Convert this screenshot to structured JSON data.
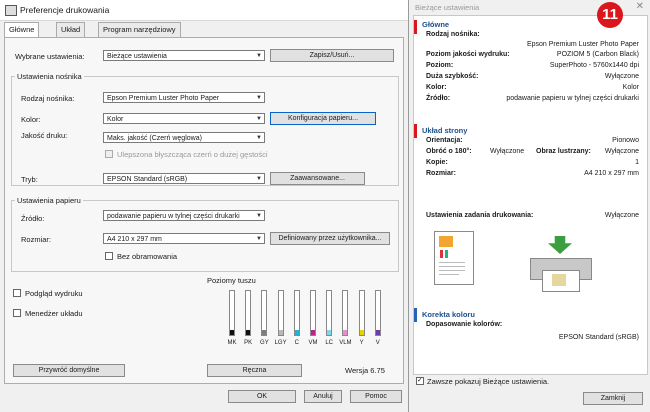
{
  "window": {
    "title": "Preferencje drukowania"
  },
  "tabs": [
    {
      "label": "Główne"
    },
    {
      "label": "Układ"
    },
    {
      "label": "Program narzędziowy"
    }
  ],
  "main": {
    "selected_settings_label": "Wybrane ustawienia:",
    "selected_settings_value": "Bieżące ustawienia",
    "save_delete_button": "Zapisz/Usuń...",
    "media_group": "Ustawienia nośnika",
    "media_type_label": "Rodzaj nośnika:",
    "media_type_value": "Epson Premium Luster Photo Paper",
    "color_label": "Kolor:",
    "color_value": "Kolor",
    "paper_config_button": "Konfiguracja papieru...",
    "quality_label": "Jakość druku:",
    "quality_value": "Maks. jakość (Czerń węglowa)",
    "enhanced_black": "Ulepszona błyszcząca czerń o dużej gęstości",
    "mode_label": "Tryb:",
    "mode_value": "EPSON Standard (sRGB)",
    "advanced_button": "Zaawansowane...",
    "paper_group": "Ustawienia papieru",
    "source_label": "Źródło:",
    "source_value": "podawanie papieru w tylnej części drukarki",
    "size_label": "Rozmiar:",
    "size_value": "A4 210 x 297 mm",
    "user_defined_button": "Definiowany przez użytkownika...",
    "borderless_label": "Bez obramowania",
    "print_preview_label": "Podgląd wydruku",
    "layout_manager_label": "Menedżer układu",
    "ink_levels_title": "Poziomy tuszu",
    "inks": [
      {
        "name": "MK",
        "color": "#111111",
        "level": 0.12
      },
      {
        "name": "PK",
        "color": "#111111",
        "level": 0.12
      },
      {
        "name": "GY",
        "color": "#7d7d7d",
        "level": 0.12
      },
      {
        "name": "LGY",
        "color": "#b9b9b9",
        "level": 0.12
      },
      {
        "name": "C",
        "color": "#20b4d2",
        "level": 0.12
      },
      {
        "name": "VM",
        "color": "#c0248c",
        "level": 0.12
      },
      {
        "name": "LC",
        "color": "#7fd6ea",
        "level": 0.12
      },
      {
        "name": "VLM",
        "color": "#e38fd0",
        "level": 0.12
      },
      {
        "name": "Y",
        "color": "#e8d200",
        "level": 0.12
      },
      {
        "name": "V",
        "color": "#6a3cb0",
        "level": 0.12
      }
    ],
    "restore_defaults_button": "Przywróć domyślne",
    "manual_button": "Ręczna",
    "version_text": "Wersja 6.75",
    "ok_button": "OK",
    "cancel_button": "Anuluj",
    "help_button": "Pomoc"
  },
  "summary": {
    "window_title": "Bieżące ustawienia",
    "badge": "11",
    "main_section": "Główne",
    "media_type_label": "Rodzaj nośnika:",
    "media_type_value": "Epson Premium Luster Photo Paper",
    "quality_level_label": "Poziom jakości wydruku:",
    "quality_level_value": "POZIOM 5 (Carbon Black)",
    "level_label": "Poziom:",
    "level_value": "SuperPhoto - 5760x1440 dpi",
    "high_speed_label": "Duża szybkość:",
    "high_speed_value": "Wyłączone",
    "color_label": "Kolor:",
    "color_value": "Kolor",
    "source_label": "Źródło:",
    "source_value": "podawanie papieru w tylnej części drukarki",
    "layout_section": "Układ strony",
    "orientation_label": "Orientacja:",
    "orientation_value": "Pionowo",
    "rotate_label": "Obróć o 180°:",
    "rotate_value": "Wyłączone",
    "mirror_label": "Obraz lustrzany:",
    "mirror_value": "Wyłączone",
    "copies_label": "Kopie:",
    "copies_value": "1",
    "size_label": "Rozmiar:",
    "size_value": "A4 210 x 297 mm",
    "job_settings_label": "Ustawienia zadania drukowania:",
    "job_settings_value": "Wyłączone",
    "color_corr_section": "Korekta koloru",
    "color_match_label": "Dopasowanie kolorów:",
    "color_match_value": "EPSON Standard (sRGB)",
    "always_show_label": "Zawsze pokazuj Bieżące ustawienia.",
    "close_button": "Zamknij"
  },
  "colors": {
    "accent_blue": "#1c4e8c",
    "marker_red": "#d9171c",
    "marker_blue": "#2a62b8",
    "badge_red": "#d9171c"
  }
}
